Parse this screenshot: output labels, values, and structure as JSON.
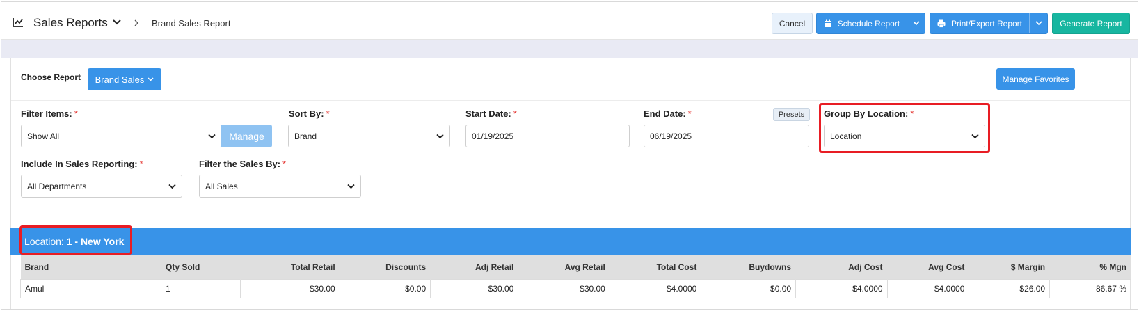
{
  "header": {
    "title": "Sales Reports",
    "breadcrumb": "Brand Sales Report",
    "buttons": {
      "cancel": "Cancel",
      "schedule": "Schedule Report",
      "print": "Print/Export Report",
      "generate": "Generate Report"
    }
  },
  "report": {
    "choose_label": "Choose Report",
    "selected": "Brand Sales",
    "manage_favorites": "Manage Favorites"
  },
  "filters": {
    "filter_items": {
      "label": "Filter Items:",
      "value": "Show All",
      "manage": "Manage"
    },
    "sort_by": {
      "label": "Sort By:",
      "value": "Brand"
    },
    "start_date": {
      "label": "Start Date:",
      "value": "01/19/2025"
    },
    "end_date": {
      "label": "End Date:",
      "value": "06/19/2025",
      "presets": "Presets"
    },
    "group_by": {
      "label": "Group By Location:",
      "value": "Location"
    },
    "include": {
      "label": "Include In Sales Reporting:",
      "value": "All Departments"
    },
    "filter_sales": {
      "label": "Filter the Sales By:",
      "value": "All Sales"
    },
    "required_mark": "*"
  },
  "location": {
    "prefix": "Location: ",
    "name": "1 - New York"
  },
  "table": {
    "columns": [
      "Brand",
      "Qty Sold",
      "Total Retail",
      "Discounts",
      "Adj Retail",
      "Avg Retail",
      "Total Cost",
      "Buydowns",
      "Adj Cost",
      "Avg Cost",
      "$ Margin",
      "% Mgn"
    ],
    "rows": [
      [
        "Amul",
        "1",
        "$30.00",
        "$0.00",
        "$30.00",
        "$30.00",
        "$4.0000",
        "$0.00",
        "$4.0000",
        "$4.0000",
        "$26.00",
        "86.67 %"
      ]
    ]
  },
  "colors": {
    "primary": "#3893e8",
    "teal": "#17b6a0",
    "highlight": "#e81d24"
  },
  "icons": [
    "chart-line-icon",
    "chevron-down-icon",
    "chevron-right-icon",
    "calendar-icon",
    "printer-icon"
  ]
}
